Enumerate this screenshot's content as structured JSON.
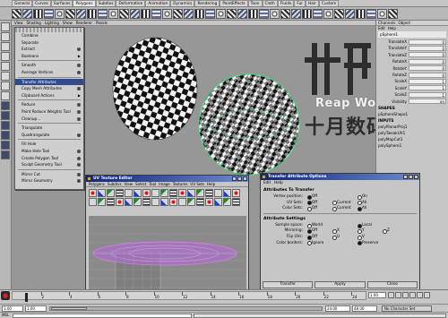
{
  "shelf_tabs": [
    "General",
    "Curves",
    "Surfaces",
    "Polygons",
    "Subdivs",
    "Deformation",
    "Animation",
    "Dynamics",
    "Rendering",
    "PaintEffects",
    "Toon",
    "Cloth",
    "Fluids",
    "Fur",
    "Hair",
    "Custom"
  ],
  "viewport_menu": [
    "View",
    "Shading",
    "Lighting",
    "Show",
    "Renderer",
    "Panels"
  ],
  "dropdown": {
    "items": [
      {
        "label": "Combine",
        "type": "item"
      },
      {
        "label": "Separate",
        "type": "item"
      },
      {
        "label": "Extract",
        "type": "option"
      },
      {
        "label": "Booleans",
        "type": "submenu"
      },
      {
        "type": "sep"
      },
      {
        "label": "Smooth",
        "type": "option"
      },
      {
        "label": "Average Vertices",
        "type": "option"
      },
      {
        "type": "sep"
      },
      {
        "label": "Transfer Attributes",
        "type": "option",
        "highlight": true
      },
      {
        "label": "Copy Mesh Attributes",
        "type": "option"
      },
      {
        "label": "Clipboard Actions",
        "type": "submenu"
      },
      {
        "type": "sep"
      },
      {
        "label": "Reduce",
        "type": "option"
      },
      {
        "label": "Paint Reduce Weights Tool",
        "type": "option"
      },
      {
        "label": "Cleanup...",
        "type": "option"
      },
      {
        "type": "sep"
      },
      {
        "label": "Triangulate",
        "type": "item"
      },
      {
        "label": "Quadrangulate",
        "type": "option"
      },
      {
        "type": "sep"
      },
      {
        "label": "Fill Hole",
        "type": "item"
      },
      {
        "label": "Make Hole Tool",
        "type": "option"
      },
      {
        "label": "Create Polygon Tool",
        "type": "option"
      },
      {
        "label": "Sculpt Geometry Tool",
        "type": "option"
      },
      {
        "type": "sep"
      },
      {
        "label": "Mirror Cut",
        "type": "option"
      },
      {
        "label": "Mirror Geometry",
        "type": "option"
      }
    ]
  },
  "channel_box": {
    "tabs": [
      "Channels",
      "Object"
    ],
    "subtabs": [
      "Edit",
      "Help"
    ],
    "object": "pSphere1",
    "attrs": [
      {
        "name": "TranslateX",
        "value": "0"
      },
      {
        "name": "TranslateY",
        "value": "0"
      },
      {
        "name": "TranslateZ",
        "value": "0"
      },
      {
        "name": "RotateX",
        "value": "0"
      },
      {
        "name": "RotateY",
        "value": "0"
      },
      {
        "name": "RotateZ",
        "value": "0"
      },
      {
        "name": "ScaleX",
        "value": "1"
      },
      {
        "name": "ScaleY",
        "value": "1"
      },
      {
        "name": "ScaleZ",
        "value": "1"
      },
      {
        "name": "Visibility",
        "value": "on"
      }
    ],
    "shapes_label": "SHAPES",
    "shape": "pSphereShape1",
    "inputs_label": "INPUTS",
    "inputs": [
      "polyPlanarProj1",
      "polyTweakUV1",
      "polyMapCut1",
      "polySphere1"
    ]
  },
  "watermark": {
    "brand": "Reap Works",
    "cn": "十月数码"
  },
  "uv_editor": {
    "title": "UV Texture Editor",
    "menu": [
      "Polygons",
      "Subdivs",
      "View",
      "Select",
      "Tool",
      "Image",
      "Textures",
      "UV Sets",
      "Help"
    ]
  },
  "transfer_options": {
    "title": "Transfer Attribute Options",
    "menu": [
      "Edit",
      "Help"
    ],
    "section1": "Attributes To Transfer",
    "section2": "Attribute Settings",
    "rows1": [
      {
        "label": "Vertex position:",
        "opts": [
          {
            "t": "Off",
            "on": true,
            "x": 0
          },
          {
            "t": "On",
            "on": false,
            "x": 2
          }
        ]
      },
      {
        "label": "UV Sets:",
        "opts": [
          {
            "t": "Off",
            "on": true,
            "x": 0
          },
          {
            "t": "Current",
            "on": false,
            "x": 1
          },
          {
            "t": "All",
            "on": false,
            "x": 2
          }
        ]
      },
      {
        "label": "Color Sets:",
        "opts": [
          {
            "t": "Off",
            "on": false,
            "x": 0
          },
          {
            "t": "Current",
            "on": false,
            "x": 1
          },
          {
            "t": "All",
            "on": true,
            "x": 2
          }
        ]
      }
    ],
    "rows2": [
      {
        "label": "Sample space:",
        "opts": [
          {
            "t": "World",
            "on": false,
            "x": 0
          },
          {
            "t": "Local",
            "on": true,
            "x": 2
          }
        ]
      },
      {
        "label": "Mirroring:",
        "opts": [
          {
            "t": "Off",
            "on": true,
            "x": 0
          },
          {
            "t": "X",
            "on": false,
            "x": 1
          },
          {
            "t": "Y",
            "on": false,
            "x": 2
          },
          {
            "t": "Z",
            "on": false,
            "x": 3
          }
        ]
      },
      {
        "label": "Flip UVs:",
        "opts": [
          {
            "t": "Off",
            "on": true,
            "x": 0
          },
          {
            "t": "U",
            "on": false,
            "x": 1
          },
          {
            "t": "V",
            "on": false,
            "x": 2
          }
        ]
      },
      {
        "label": "Color borders:",
        "opts": [
          {
            "t": "Ignore",
            "on": false,
            "x": 0
          },
          {
            "t": "Preserve",
            "on": true,
            "x": 2
          }
        ]
      }
    ],
    "buttons": [
      "Transfer",
      "Apply",
      "Close"
    ]
  },
  "timeline": {
    "ticks": [
      "2",
      "4",
      "6",
      "8",
      "10",
      "12",
      "14",
      "16",
      "18",
      "20",
      "22",
      "24"
    ],
    "current_frame": "1.00"
  },
  "range": {
    "start": "1.00",
    "inner_start": "1.00",
    "inner_end": "24.00",
    "end": "48.00",
    "character": "No Character Set"
  },
  "cmd": {
    "label": "MEL"
  }
}
